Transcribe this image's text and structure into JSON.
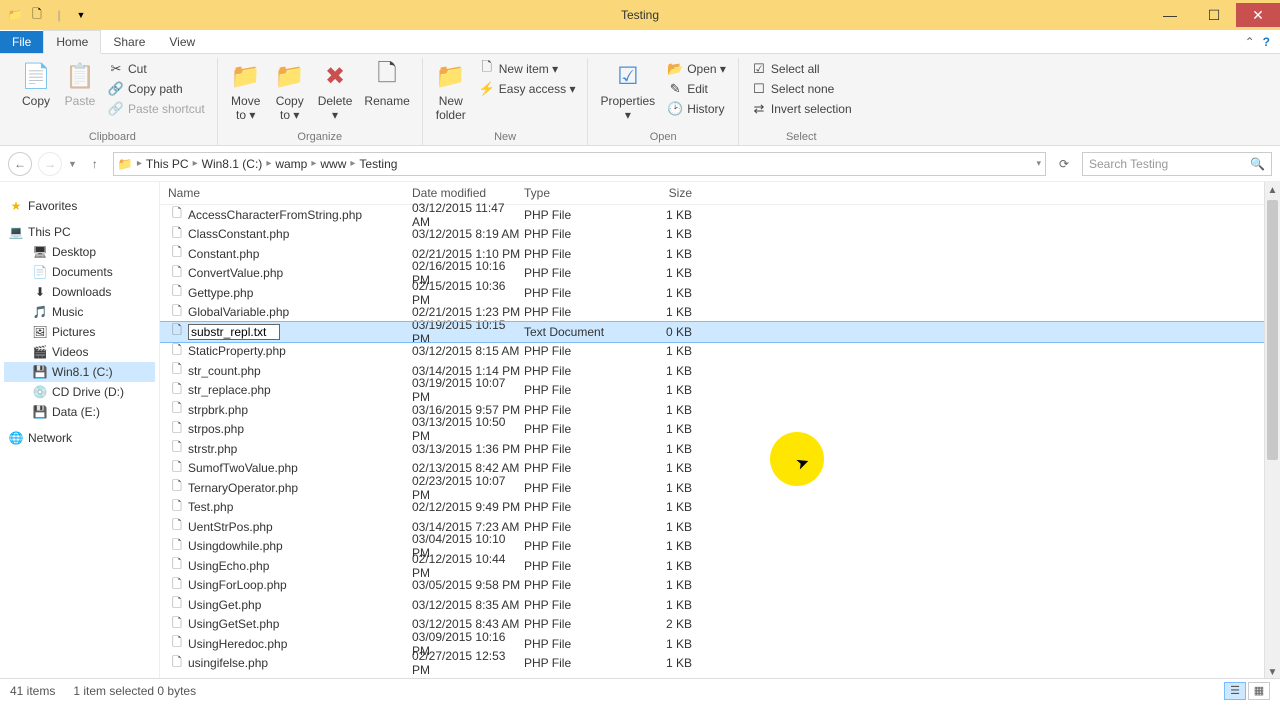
{
  "window": {
    "title": "Testing"
  },
  "tabs": {
    "file": "File",
    "home": "Home",
    "share": "Share",
    "view": "View"
  },
  "ribbon": {
    "clipboard": {
      "copy": "Copy",
      "paste": "Paste",
      "cut": "Cut",
      "copy_path": "Copy path",
      "paste_shortcut": "Paste shortcut",
      "label": "Clipboard"
    },
    "organize": {
      "move_to": "Move\nto ▾",
      "copy_to": "Copy\nto ▾",
      "delete": "Delete\n▾",
      "rename": "Rename",
      "label": "Organize"
    },
    "new": {
      "new_folder": "New\nfolder",
      "new_item": "New item ▾",
      "easy_access": "Easy access ▾",
      "label": "New"
    },
    "open": {
      "properties": "Properties\n▾",
      "open": "Open ▾",
      "edit": "Edit",
      "history": "History",
      "label": "Open"
    },
    "select": {
      "select_all": "Select all",
      "select_none": "Select none",
      "invert": "Invert selection",
      "label": "Select"
    }
  },
  "breadcrumb": [
    "This PC",
    "Win8.1 (C:)",
    "wamp",
    "www",
    "Testing"
  ],
  "search": {
    "placeholder": "Search Testing"
  },
  "navpane": {
    "favorites": "Favorites",
    "this_pc": "This PC",
    "items": [
      "Desktop",
      "Documents",
      "Downloads",
      "Music",
      "Pictures",
      "Videos",
      "Win8.1 (C:)",
      "CD Drive (D:)",
      "Data (E:)"
    ],
    "network": "Network"
  },
  "columns": {
    "name": "Name",
    "date": "Date modified",
    "type": "Type",
    "size": "Size"
  },
  "editing_filename": "substr_repl.txt",
  "files": [
    {
      "name": "AccessCharacterFromString.php",
      "date": "03/12/2015 11:47 AM",
      "type": "PHP File",
      "size": "1 KB"
    },
    {
      "name": "ClassConstant.php",
      "date": "03/12/2015 8:19 AM",
      "type": "PHP File",
      "size": "1 KB"
    },
    {
      "name": "Constant.php",
      "date": "02/21/2015 1:10 PM",
      "type": "PHP File",
      "size": "1 KB"
    },
    {
      "name": "ConvertValue.php",
      "date": "02/16/2015 10:16 PM",
      "type": "PHP File",
      "size": "1 KB"
    },
    {
      "name": "Gettype.php",
      "date": "02/15/2015 10:36 PM",
      "type": "PHP File",
      "size": "1 KB"
    },
    {
      "name": "GlobalVariable.php",
      "date": "02/21/2015 1:23 PM",
      "type": "PHP File",
      "size": "1 KB"
    },
    {
      "name": "substr_repl.txt",
      "date": "03/19/2015 10:15 PM",
      "type": "Text Document",
      "size": "0 KB",
      "selected": true,
      "editing": true
    },
    {
      "name": "StaticProperty.php",
      "date": "03/12/2015 8:15 AM",
      "type": "PHP File",
      "size": "1 KB"
    },
    {
      "name": "str_count.php",
      "date": "03/14/2015 1:14 PM",
      "type": "PHP File",
      "size": "1 KB"
    },
    {
      "name": "str_replace.php",
      "date": "03/19/2015 10:07 PM",
      "type": "PHP File",
      "size": "1 KB"
    },
    {
      "name": "strpbrk.php",
      "date": "03/16/2015 9:57 PM",
      "type": "PHP File",
      "size": "1 KB"
    },
    {
      "name": "strpos.php",
      "date": "03/13/2015 10:50 PM",
      "type": "PHP File",
      "size": "1 KB"
    },
    {
      "name": "strstr.php",
      "date": "03/13/2015 1:36 PM",
      "type": "PHP File",
      "size": "1 KB"
    },
    {
      "name": "SumofTwoValue.php",
      "date": "02/13/2015 8:42 AM",
      "type": "PHP File",
      "size": "1 KB"
    },
    {
      "name": "TernaryOperator.php",
      "date": "02/23/2015 10:07 PM",
      "type": "PHP File",
      "size": "1 KB"
    },
    {
      "name": "Test.php",
      "date": "02/12/2015 9:49 PM",
      "type": "PHP File",
      "size": "1 KB"
    },
    {
      "name": "UentStrPos.php",
      "date": "03/14/2015 7:23 AM",
      "type": "PHP File",
      "size": "1 KB"
    },
    {
      "name": "Usingdowhile.php",
      "date": "03/04/2015 10:10 PM",
      "type": "PHP File",
      "size": "1 KB"
    },
    {
      "name": "UsingEcho.php",
      "date": "02/12/2015 10:44 PM",
      "type": "PHP File",
      "size": "1 KB"
    },
    {
      "name": "UsingForLoop.php",
      "date": "03/05/2015 9:58 PM",
      "type": "PHP File",
      "size": "1 KB"
    },
    {
      "name": "UsingGet.php",
      "date": "03/12/2015 8:35 AM",
      "type": "PHP File",
      "size": "1 KB"
    },
    {
      "name": "UsingGetSet.php",
      "date": "03/12/2015 8:43 AM",
      "type": "PHP File",
      "size": "2 KB"
    },
    {
      "name": "UsingHeredoc.php",
      "date": "03/09/2015 10:16 PM",
      "type": "PHP File",
      "size": "1 KB"
    },
    {
      "name": "usingifelse.php",
      "date": "02/27/2015 12:53 PM",
      "type": "PHP File",
      "size": "1 KB"
    }
  ],
  "status": {
    "count": "41 items",
    "selection": "1 item selected  0 bytes"
  }
}
